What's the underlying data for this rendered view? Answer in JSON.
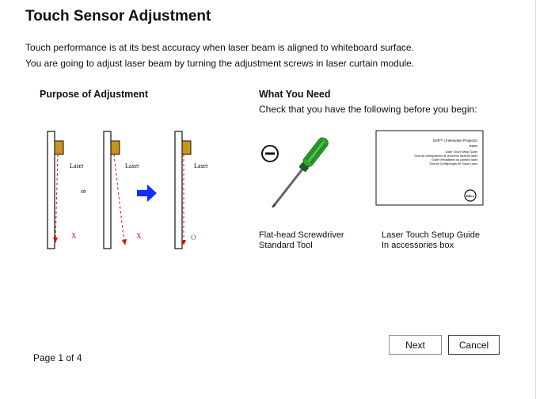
{
  "title": "Touch Sensor Adjustment",
  "intro": [
    "Touch performance is at its best accuracy when laser beam is aligned to whiteboard surface.",
    "You are going to adjust laser beam by turning the adjustment screws in laser curtain module."
  ],
  "purpose": {
    "heading": "Purpose of Adjustment",
    "diagram": {
      "laser_label": "Laser",
      "or_label": "or",
      "bad_mark": "X",
      "good_mark": "O"
    }
  },
  "need": {
    "heading": "What You Need",
    "subheading": "Check that you have the following before you begin:",
    "items": [
      {
        "line1": "Flat-head Screwdriver",
        "line2": "Standard Tool"
      },
      {
        "line1": "Laser Touch Setup Guide",
        "line2": "In accessories box"
      }
    ],
    "guide_booklet": {
      "lines": [
        "Dell™ | Interactive Projector",
        "S520",
        "Laser Touch Setup Guide",
        "Guía de configuración de la función táctil del láser",
        "Guide d'installation du pointeur laser",
        "Guia de Configuração de Toque Laser"
      ],
      "logo": "DELL"
    }
  },
  "buttons": {
    "next": "Next",
    "cancel": "Cancel"
  },
  "page_indicator": "Page 1 of 4",
  "colors": {
    "laser_bad": "#d01010",
    "good": "#1a9a1a",
    "arrow": "#1030ff",
    "module": "#c8941a"
  }
}
